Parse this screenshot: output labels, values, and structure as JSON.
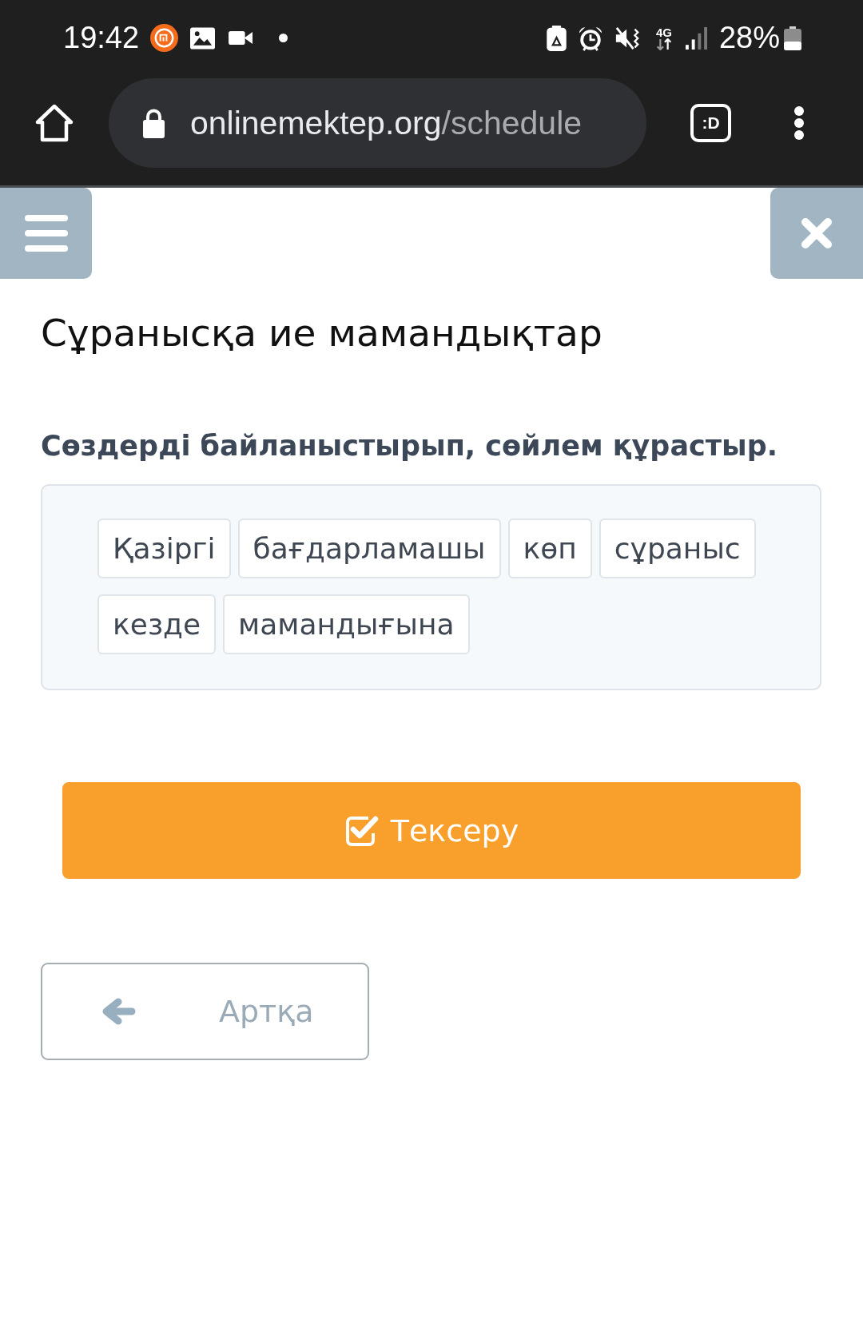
{
  "status_bar": {
    "time": "19:42",
    "network": "4G",
    "battery": "28%"
  },
  "browser": {
    "url_domain": "onlinemektep.org",
    "url_path": "/schedule",
    "tab_switcher": ":D"
  },
  "page": {
    "title": "Сұранысқа ие мамандықтар",
    "instruction": "Сөздерді байланыстырып, сөйлем құрастыр.",
    "words": [
      "Қазіргі",
      "бағдарламашы",
      "көп",
      "сұраныс",
      "кезде",
      "мамандығына"
    ],
    "check_button": "Тексеру",
    "back_button": "Артқа"
  }
}
